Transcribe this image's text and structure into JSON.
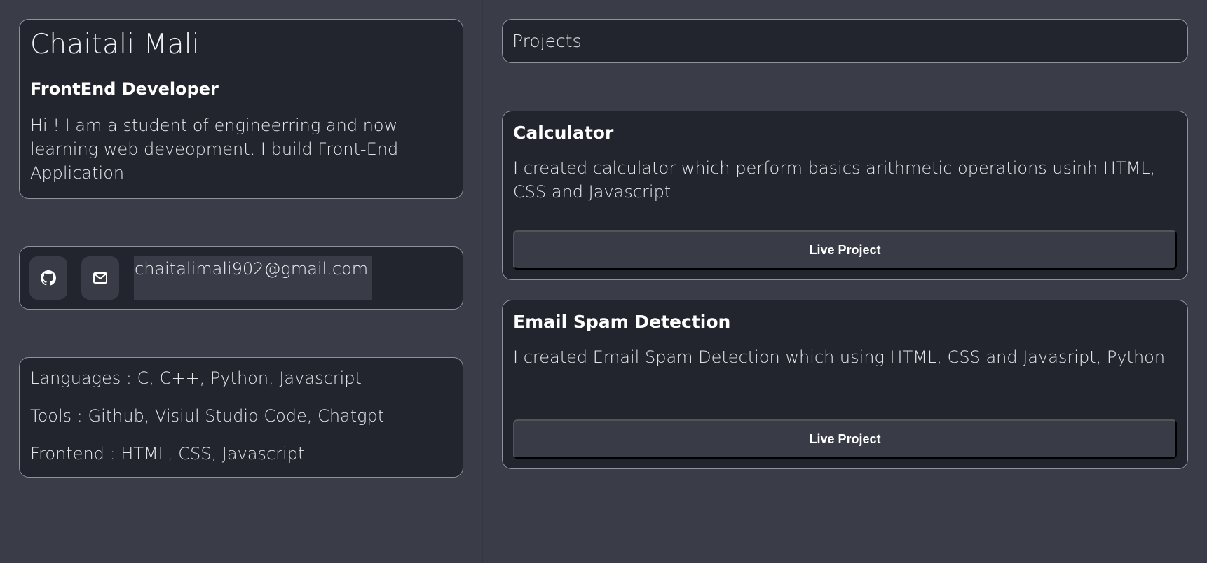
{
  "profile": {
    "name": "Chaitali Mali",
    "role": "FrontEnd Developer",
    "bio": "Hi ! I am a student of engineerring and now learning web deveopment. I build Front-End Application"
  },
  "contact": {
    "github_icon": "github-icon",
    "mail_icon": "mail-icon",
    "email": "chaitalimali902@gmail.com"
  },
  "skills": [
    "Languages : C, C++, Python, Javascript",
    "Tools : Github, Visiul Studio Code, Chatgpt",
    "Frontend : HTML, CSS, Javascript"
  ],
  "projects": {
    "header": "Projects",
    "items": [
      {
        "title": "Calculator",
        "description": "I created calculator which perform basics arithmetic operations usinh HTML, CSS and Javascript",
        "button_label": "Live Project"
      },
      {
        "title": "Email Spam Detection",
        "description": "I created Email Spam Detection which using HTML, CSS and Javasript, Python",
        "button_label": "Live Project"
      }
    ]
  },
  "colors": {
    "background": "#3a3d47",
    "card": "#22252e",
    "card_border": "#8f929c",
    "button": "#393c46"
  }
}
